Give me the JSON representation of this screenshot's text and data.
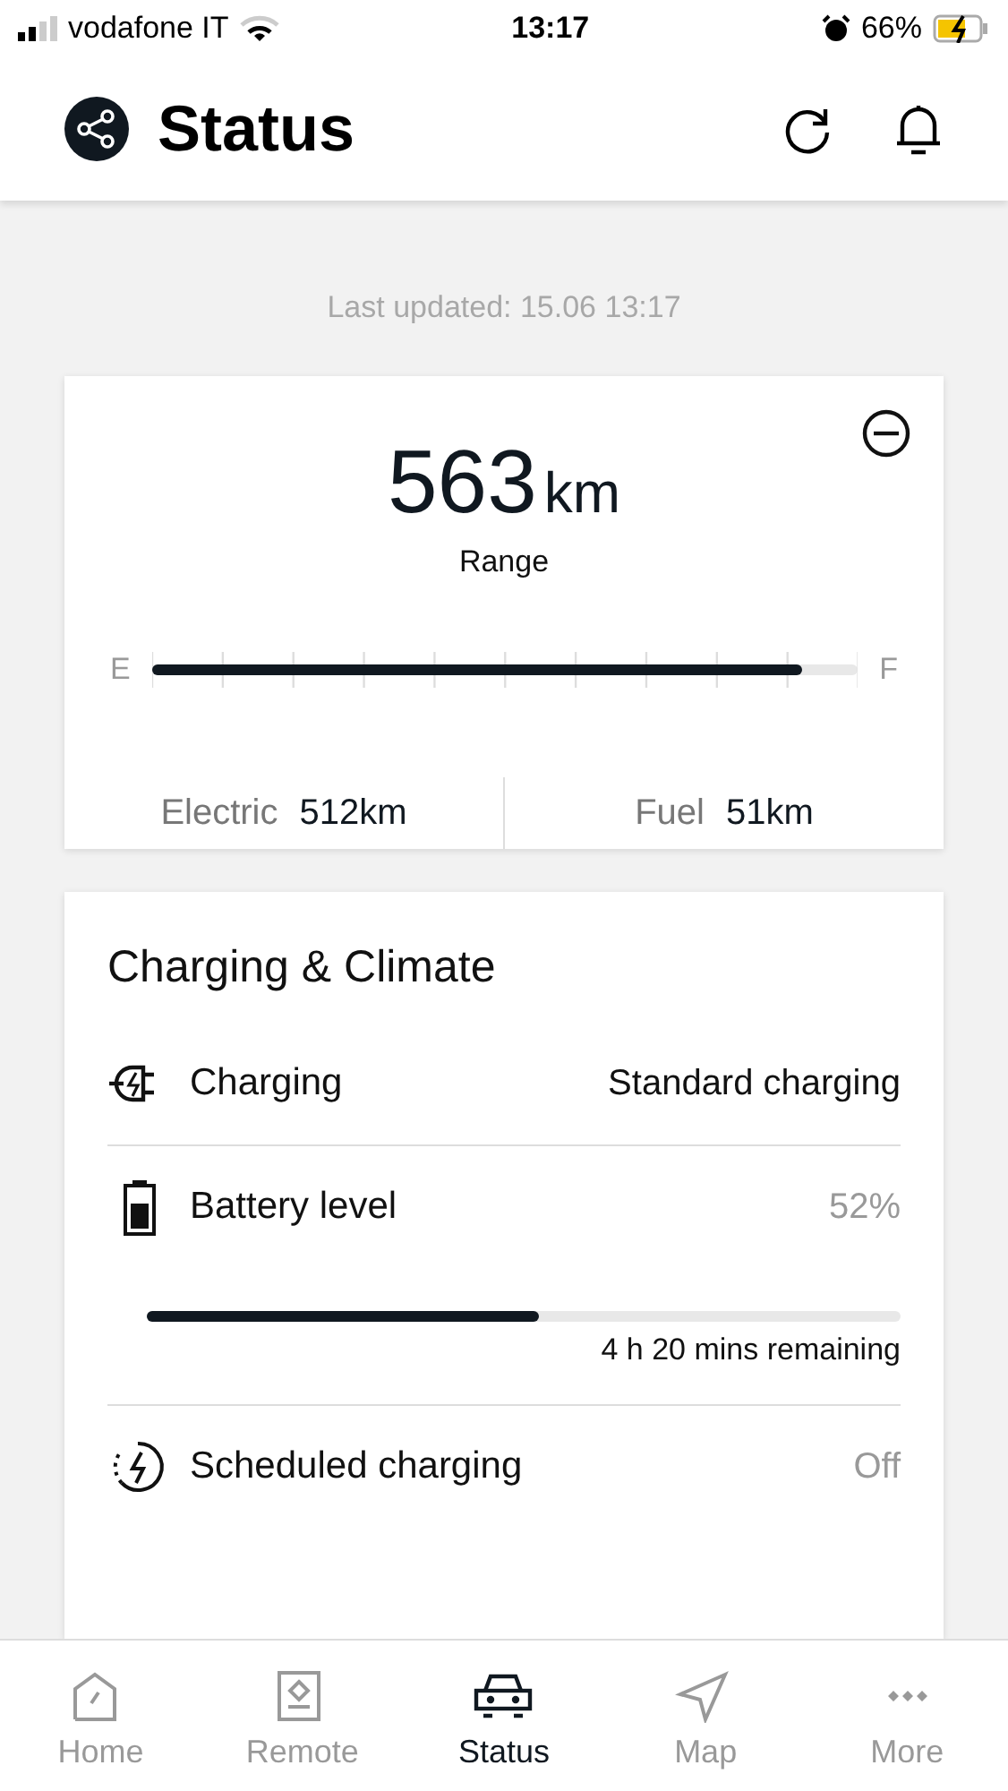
{
  "status_bar": {
    "carrier": "vodafone IT",
    "time": "13:17",
    "battery": "66%"
  },
  "header": {
    "title": "Status"
  },
  "last_updated": "Last updated: 15.06 13:17",
  "range_card": {
    "value": "563",
    "unit": "km",
    "label": "Range",
    "gauge": {
      "start_label": "E",
      "end_label": "F",
      "level": 0.92
    },
    "split": [
      {
        "label": "Electric",
        "value": "512km"
      },
      {
        "label": "Fuel",
        "value": "51km"
      }
    ]
  },
  "charging_card": {
    "title": "Charging & Climate",
    "rows": [
      {
        "kind": "plug",
        "label": "Charging",
        "value": "Standard charging"
      },
      {
        "kind": "battery",
        "label": "Battery level",
        "value": "52%",
        "level": 0.52,
        "note": "4 h 20 mins remaining"
      },
      {
        "kind": "schedule",
        "label": "Scheduled charging",
        "value": "Off"
      }
    ]
  },
  "tabs": [
    {
      "label": "Home",
      "selected": false
    },
    {
      "label": "Remote",
      "selected": false
    },
    {
      "label": "Status",
      "selected": true
    },
    {
      "label": "Map",
      "selected": false
    },
    {
      "label": "More",
      "selected": false
    }
  ]
}
